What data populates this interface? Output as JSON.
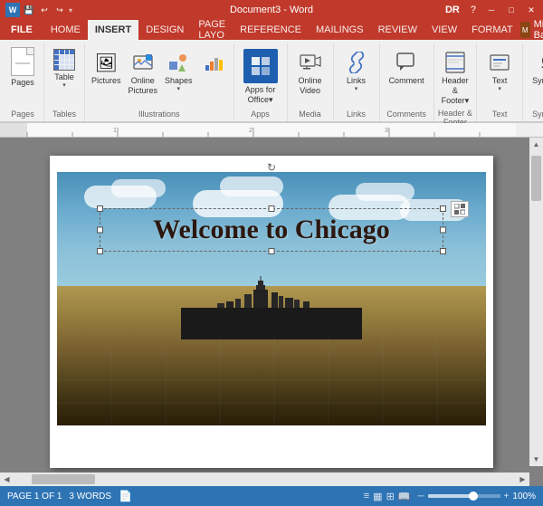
{
  "titlebar": {
    "doc_name": "Document3 - Word",
    "dr_label": "DR",
    "help": "?",
    "minimize": "─",
    "restore": "□",
    "close": "✕",
    "quick_access": [
      "💾",
      "↩",
      "↪"
    ]
  },
  "ribbon": {
    "active_tab": "INSERT",
    "tabs": [
      "FILE",
      "HOME",
      "INSERT",
      "DESIGN",
      "PAGE LAYO",
      "REFERENCE",
      "MAILINGS",
      "REVIEW",
      "VIEW",
      "FORMAT"
    ],
    "user": "Mitch Bar...",
    "groups": [
      {
        "id": "pages",
        "label": "Pages",
        "buttons": [
          {
            "id": "pages",
            "label": "Pages",
            "icon": "pages"
          }
        ]
      },
      {
        "id": "tables",
        "label": "Tables",
        "buttons": [
          {
            "id": "table",
            "label": "Table",
            "icon": "table"
          }
        ]
      },
      {
        "id": "illustrations",
        "label": "Illustrations",
        "buttons": [
          {
            "id": "pictures",
            "label": "Pictures",
            "icon": "🖼"
          },
          {
            "id": "online-pictures",
            "label": "Online\nPictures",
            "icon": "🌐"
          },
          {
            "id": "shapes",
            "label": "Shapes",
            "icon": "shapes"
          },
          {
            "id": "smartart",
            "label": "",
            "icon": "📊"
          }
        ]
      },
      {
        "id": "apps",
        "label": "Apps",
        "buttons": [
          {
            "id": "apps-for-office",
            "label": "Apps for\nOffice▾",
            "icon": "apps"
          }
        ]
      },
      {
        "id": "media",
        "label": "Media",
        "buttons": [
          {
            "id": "online-video",
            "label": "Online\nVideo",
            "icon": "📹"
          }
        ]
      },
      {
        "id": "links",
        "label": "Links",
        "buttons": [
          {
            "id": "links",
            "label": "Links",
            "icon": "🔗"
          }
        ]
      },
      {
        "id": "comments",
        "label": "Comments",
        "buttons": [
          {
            "id": "comment",
            "label": "Comment",
            "icon": "💬"
          }
        ]
      },
      {
        "id": "header-footer",
        "label": "Header & Footer",
        "buttons": [
          {
            "id": "header-footer",
            "label": "Header &\nFooter▾",
            "icon": "header"
          }
        ]
      },
      {
        "id": "text",
        "label": "Text",
        "buttons": [
          {
            "id": "text",
            "label": "Text",
            "icon": "A"
          }
        ]
      },
      {
        "id": "symbols",
        "label": "Symbols",
        "buttons": [
          {
            "id": "symbols",
            "label": "Symbols",
            "icon": "Ω"
          }
        ]
      }
    ]
  },
  "document": {
    "content": "Welcome to Chicago",
    "page_info": "PAGE 1 OF 1",
    "word_count": "3 WORDS",
    "zoom": "100%"
  },
  "statusbar": {
    "page": "PAGE 1 OF 1",
    "words": "3 WORDS",
    "proofing_icon": "📄",
    "zoom": "100%",
    "view_icons": [
      "≡",
      "▦",
      "⊞",
      "📖"
    ]
  }
}
